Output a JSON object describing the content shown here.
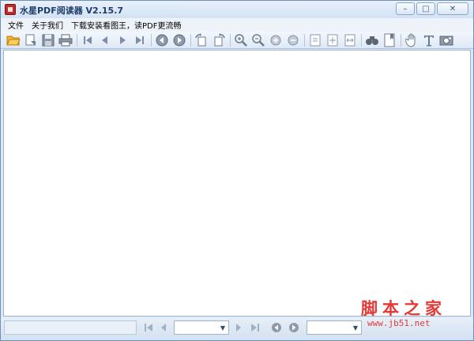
{
  "window": {
    "title": "水星PDF阅读器 V2.15.7"
  },
  "menu": {
    "items": [
      {
        "label": "文件"
      },
      {
        "label": "关于我们"
      },
      {
        "label": "下载安装看图王，读PDF更流畅"
      }
    ]
  },
  "toolbar": {
    "icons": [
      "open-folder-icon",
      "open-recent-icon",
      "save-icon",
      "print-icon",
      "first-page-icon",
      "previous-page-icon",
      "next-page-icon",
      "last-page-icon",
      "back-icon",
      "forward-icon",
      "rotate-left-icon",
      "rotate-right-icon",
      "zoom-in-icon",
      "zoom-out-icon",
      "zoom-in-small-icon",
      "zoom-out-small-icon",
      "actual-size-icon",
      "fit-page-icon",
      "fit-width-icon",
      "find-icon",
      "bookmark-icon",
      "hand-tool-icon",
      "text-select-icon",
      "snapshot-icon"
    ]
  },
  "bottombar": {
    "page_input": "",
    "zoom_input": ""
  },
  "watermark": {
    "main": "脚本之家",
    "sub": "www.jb51.net"
  },
  "colors": {
    "accent": "#1c3d66",
    "watermark": "#e53935",
    "background": "#dbe8f6"
  }
}
